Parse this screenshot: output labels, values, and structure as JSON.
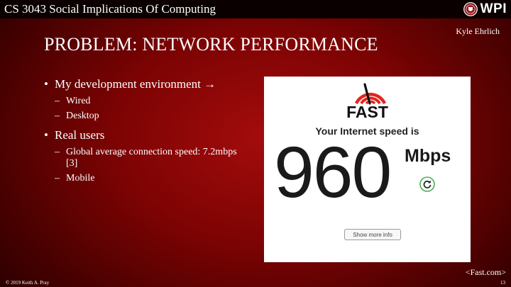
{
  "header": {
    "course_title": "CS 3043 Social Implications Of Computing",
    "logo_text": "WPI"
  },
  "author": "Kyle Ehrlich",
  "title": "PROBLEM: NETWORK PERFORMANCE",
  "bullets": [
    {
      "text": "My development environment →",
      "sub": [
        "Wired",
        "Desktop"
      ]
    },
    {
      "text": "Real users",
      "sub": [
        "Global average connection speed: 7.2mbps [3]",
        "Mobile"
      ]
    }
  ],
  "fast_screenshot": {
    "brand": "FAST",
    "label": "Your Internet speed is",
    "speed": "960",
    "unit": "Mbps",
    "show_more_label": "Show more info",
    "icon": "speedometer-icon",
    "reload_icon": "reload-icon",
    "colors": {
      "brand_red": "#e1261c",
      "reload_green": "#4caf50"
    }
  },
  "source": "<Fast.com>",
  "footer": {
    "copyright": "© 2019 Keith A. Pray",
    "page": "13"
  },
  "colors": {
    "background": "#7c0303",
    "topbar": "#0a0000"
  }
}
